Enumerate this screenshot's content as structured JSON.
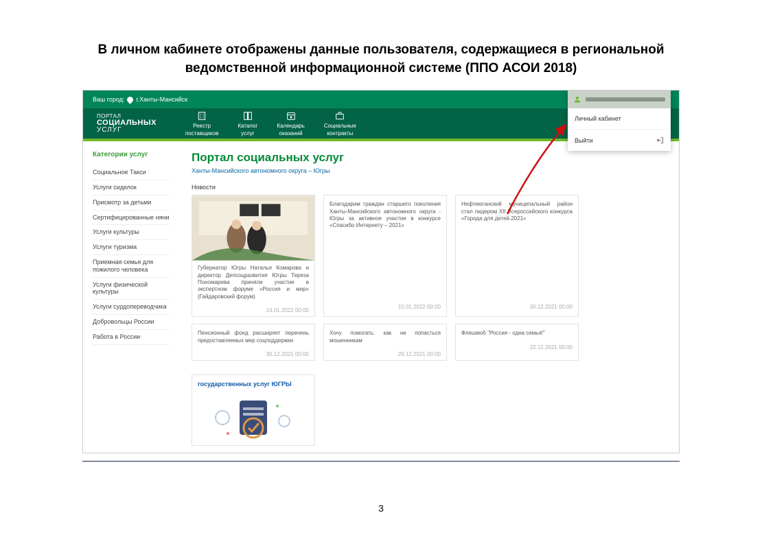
{
  "doc": {
    "title_line1": "В личном кабинете отображены данные пользователя, содержащиеся в региональной",
    "title_line2": "ведомственной информационной системе (ППО АСОИ 2018)",
    "page_number": "3"
  },
  "topbar": {
    "city_label": "Ваш город:",
    "city_value": "г.Ханты-Мансийск"
  },
  "brand": {
    "line1": "ПОРТАЛ",
    "line2": "СОЦИАЛЬНЫХ",
    "line3": "УСЛУГ"
  },
  "nav": [
    {
      "icon": "building",
      "l1": "Реестр",
      "l2": "поставщиков"
    },
    {
      "icon": "book",
      "l1": "Каталог",
      "l2": "услуг"
    },
    {
      "icon": "calendar",
      "l1": "Календарь",
      "l2": "оказаний"
    },
    {
      "icon": "briefcase",
      "l1": "Социальные",
      "l2": "контракты"
    }
  ],
  "sidebar": {
    "title": "Категории услуг",
    "items": [
      "Социальное Такси",
      "Услуги сиделок",
      "Присмотр за детьми",
      "Сертифицированные няни",
      "Услуги культуры",
      "Услуги туризма",
      "Приемная семья для пожилого человека",
      "Услуги физической культуры",
      "Услуги сурдопереводчика",
      "Добровольцы России",
      "Работа в России"
    ]
  },
  "main": {
    "title": "Портал социальных услуг",
    "subtitle": "Ханты-Мансийского автономного округа – Югры",
    "news_label": "Новости"
  },
  "news": {
    "col1": [
      {
        "has_photo": true,
        "text": "Губернатор Югры Наталья Комарова и директор Депсоцразвития Югры Тереза Пономарева приняли участие в экспертном форуме «Россия и мир» (Гайдаровский форум)",
        "date": "14.01.2022 00:00"
      },
      {
        "text": "Пенсионный фонд расширяет перечень предоставляемых мер соцподдержки",
        "date": "30.12.2021 00:00"
      }
    ],
    "col2": [
      {
        "text": "Благодарим граждан старшего поколения Ханты-Мансийского автономного округа - Югры за активное участие в конкурсе «Спасибо Интернету – 2021»",
        "date": "10.01.2022 00:00"
      },
      {
        "text": "Хочу помогать: как не попасться мошенникам",
        "date": "29.12.2021 00:00"
      }
    ],
    "col3": [
      {
        "text": "Нефтеюганский муниципальный район стал лидером XII Всероссийского конкурса «Города для детей.2021»",
        "date": "30.12.2021 00:00"
      },
      {
        "text": "Флешмоб \"Россия - одна семья!\"",
        "date": "22.12.2021 00:00"
      }
    ],
    "promo_title": "государственных услуг ЮГРЫ"
  },
  "user_menu": {
    "cabinet": "Личный кабинет",
    "logout": "Выйти"
  }
}
